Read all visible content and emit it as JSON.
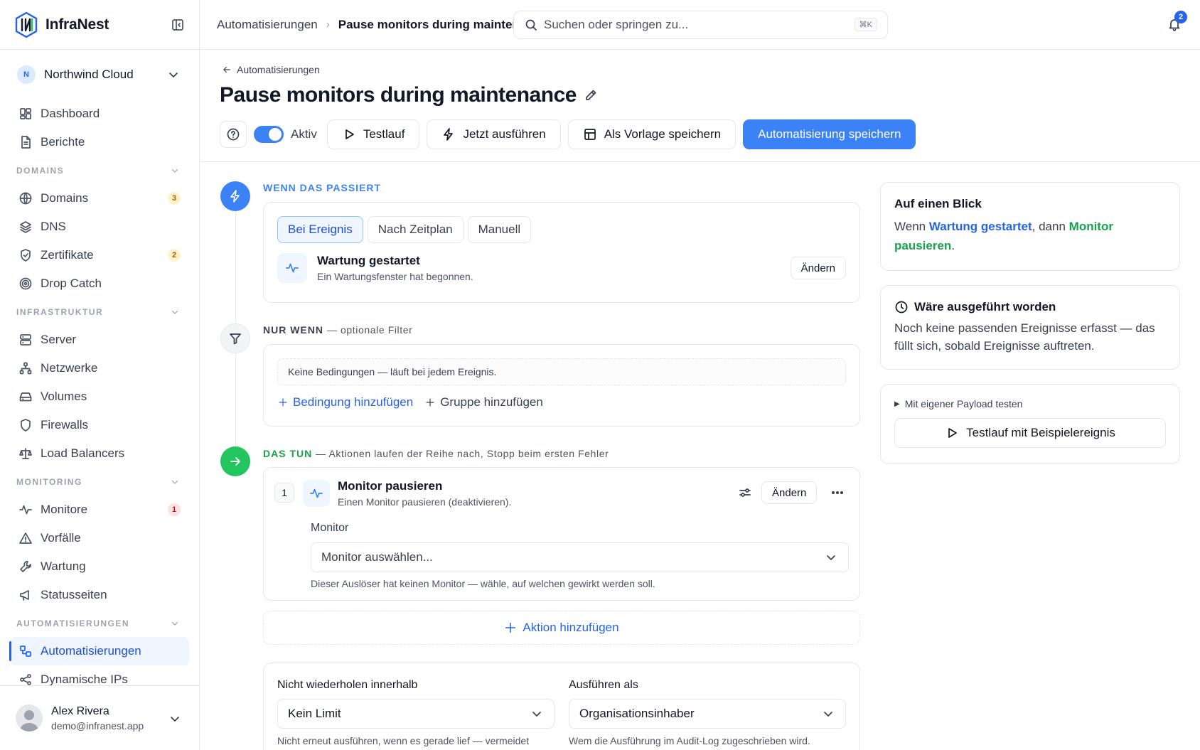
{
  "brand": {
    "name": "InfraNest"
  },
  "org": {
    "initial": "N",
    "name": "Northwind Cloud"
  },
  "nav": {
    "top": [
      {
        "label": "Dashboard"
      },
      {
        "label": "Berichte"
      }
    ],
    "domains": {
      "title": "DOMAINS",
      "items": [
        {
          "label": "Domains",
          "badge": "3"
        },
        {
          "label": "DNS"
        },
        {
          "label": "Zertifikate",
          "badge": "2"
        },
        {
          "label": "Drop Catch"
        }
      ]
    },
    "infra": {
      "title": "INFRASTRUKTUR",
      "items": [
        {
          "label": "Server"
        },
        {
          "label": "Netzwerke"
        },
        {
          "label": "Volumes"
        },
        {
          "label": "Firewalls"
        },
        {
          "label": "Load Balancers"
        }
      ]
    },
    "monitoring": {
      "title": "MONITORING",
      "items": [
        {
          "label": "Monitore",
          "badge": "1"
        },
        {
          "label": "Vorfälle"
        },
        {
          "label": "Wartung"
        },
        {
          "label": "Statusseiten"
        }
      ]
    },
    "auto": {
      "title": "AUTOMATISIERUNGEN",
      "items": [
        {
          "label": "Automatisierungen"
        },
        {
          "label": "Dynamische IPs"
        }
      ]
    }
  },
  "user": {
    "name": "Alex Rivera",
    "email": "demo@infranest.app"
  },
  "topbar": {
    "crumb_parent": "Automatisierungen",
    "crumb_current": "Pause monitors during maintenance",
    "search_placeholder": "Suchen oder springen zu...",
    "shortcut": "⌘K",
    "notifications": "2"
  },
  "page": {
    "back": "Automatisierungen",
    "title": "Pause monitors during maintenance",
    "toggle_label": "Aktiv",
    "buttons": {
      "test": "Testlauf",
      "run": "Jetzt ausführen",
      "template": "Als Vorlage speichern",
      "save": "Automatisierung speichern"
    }
  },
  "trigger": {
    "label": "WENN DAS PASSIERT",
    "tabs": [
      "Bei Ereignis",
      "Nach Zeitplan",
      "Manuell"
    ],
    "event_title": "Wartung gestartet",
    "event_desc": "Ein Wartungsfenster hat begonnen.",
    "change": "Ändern"
  },
  "filter": {
    "label": "NUR WENN",
    "sub": "— optionale Filter",
    "empty": "Keine Bedingungen — läuft bei jedem Ereignis.",
    "add_condition": "Bedingung hinzufügen",
    "add_group": "Gruppe hinzufügen"
  },
  "actions": {
    "label": "DAS TUN",
    "sub": "— Aktionen laufen der Reihe nach, Stopp beim ersten Fehler",
    "item": {
      "index": "1",
      "title": "Monitor pausieren",
      "desc": "Einen Monitor pausieren (deaktivieren).",
      "change": "Ändern",
      "field_label": "Monitor",
      "select_placeholder": "Monitor auswählen...",
      "hint": "Dieser Auslöser hat keinen Monitor — wähle, auf welchen gewirkt werden soll."
    },
    "add_action": "Aktion hinzufügen"
  },
  "settings": {
    "repeat_label": "Nicht wiederholen innerhalb",
    "repeat_value": "Kein Limit",
    "repeat_hint": "Nicht erneut ausführen, wenn es gerade lief — vermeidet",
    "runas_label": "Ausführen als",
    "runas_value": "Organisationsinhaber",
    "runas_hint": "Wem die Ausführung im Audit-Log zugeschrieben wird."
  },
  "summary": {
    "title": "Auf einen Blick",
    "pre": "Wenn ",
    "trigger": "Wartung gestartet",
    "mid": ", dann ",
    "action": "Monitor pausieren",
    "post": "."
  },
  "would_run": {
    "title": "Wäre ausgeführt worden",
    "text": "Noch keine passenden Ereignisse erfasst — das füllt sich, sobald Ereignisse auftreten."
  },
  "payload": {
    "summary": "Mit eigener Payload testen",
    "button": "Testlauf mit Beispielereignis"
  },
  "colors": {
    "accent": "#3b82f6",
    "success": "#22c55e"
  }
}
